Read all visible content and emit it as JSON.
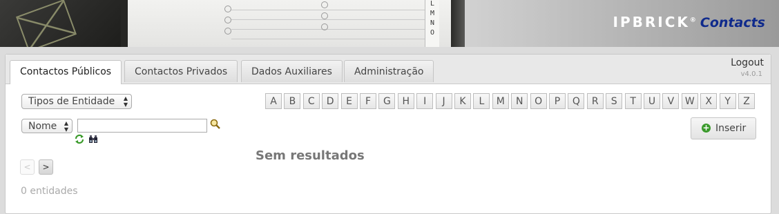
{
  "header": {
    "brand": "IPBRICK",
    "brand_mark": "®",
    "product": "Contacts",
    "book_tab_letters": [
      "L",
      "M",
      "N",
      "O"
    ]
  },
  "tabs": [
    {
      "label": "Contactos Públicos",
      "active": true
    },
    {
      "label": "Contactos Privados",
      "active": false
    },
    {
      "label": "Dados Auxiliares",
      "active": false
    },
    {
      "label": "Administração",
      "active": false
    }
  ],
  "session": {
    "logout_label": "Logout",
    "version": "v4.0.1"
  },
  "filters": {
    "entity_type_selected": "Tipos de Entidade",
    "search_field_selected": "Nome",
    "search_value": ""
  },
  "alphabet": [
    "A",
    "B",
    "C",
    "D",
    "E",
    "F",
    "G",
    "H",
    "I",
    "J",
    "K",
    "L",
    "M",
    "N",
    "O",
    "P",
    "Q",
    "R",
    "S",
    "T",
    "U",
    "V",
    "W",
    "X",
    "Y",
    "Z"
  ],
  "actions": {
    "insert_label": "Inserir"
  },
  "icons": {
    "search": "magnifier-icon",
    "refresh": "refresh-icon",
    "advanced_search": "binoculars-icon",
    "insert": "plus-circle-icon"
  },
  "results": {
    "empty_message": "Sem resultados",
    "prev_label": "<",
    "next_label": ">",
    "count_label": "0 entidades"
  },
  "colors": {
    "brand_accent": "#0f2a8c",
    "insert_icon": "#3b9a2c"
  }
}
